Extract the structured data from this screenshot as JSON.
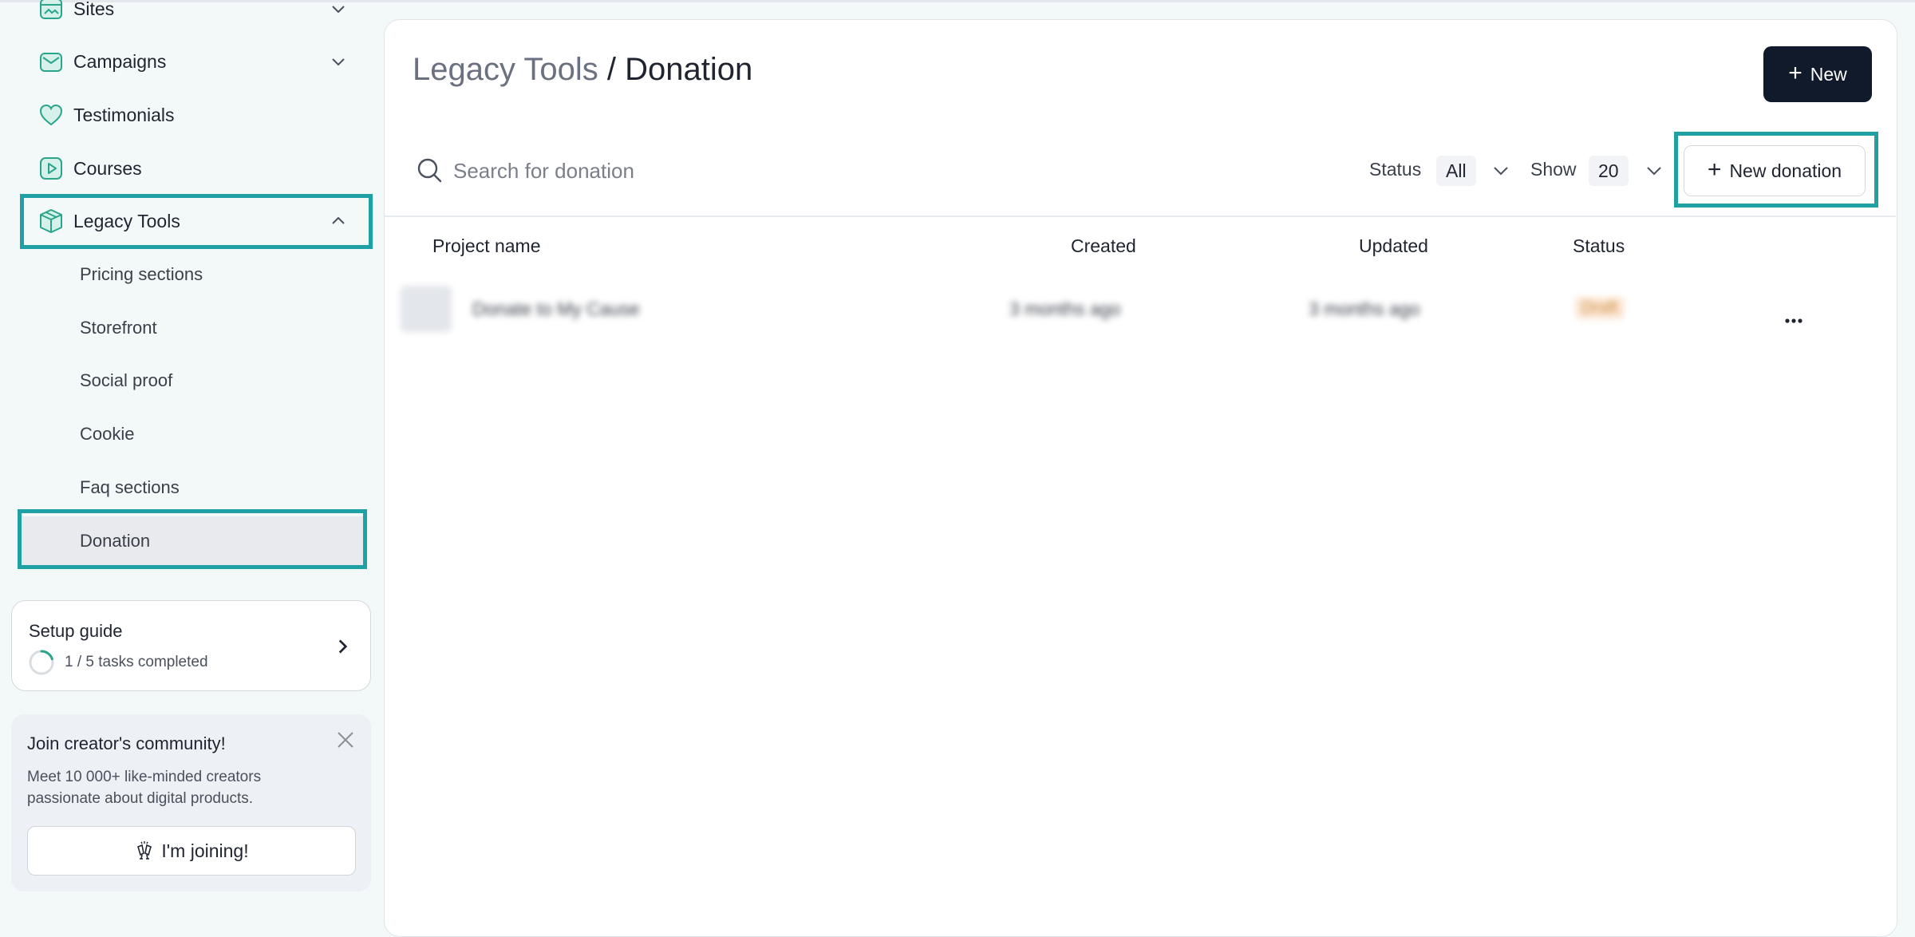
{
  "sidebar": {
    "nav": [
      {
        "label": "Sites",
        "icon": "browser-window-icon"
      },
      {
        "label": "Campaigns",
        "icon": "mail-icon"
      },
      {
        "label": "Testimonials",
        "icon": "heart-icon"
      },
      {
        "label": "Courses",
        "icon": "play-square-icon"
      },
      {
        "label": "Legacy Tools",
        "icon": "box-icon"
      }
    ],
    "legacy_items": [
      {
        "label": "Pricing sections"
      },
      {
        "label": "Storefront"
      },
      {
        "label": "Social proof"
      },
      {
        "label": "Cookie"
      },
      {
        "label": "Faq sections"
      },
      {
        "label": "Donation"
      }
    ],
    "active_item": "Donation",
    "setup_guide": {
      "title": "Setup guide",
      "progress_text": "1 / 5 tasks completed",
      "completed": 1,
      "total": 5
    },
    "community": {
      "title": "Join creator's community!",
      "description": "Meet 10 000+ like-minded creators passionate about digital products.",
      "button_label": "I'm joining!"
    }
  },
  "main": {
    "breadcrumb": {
      "parent": "Legacy Tools",
      "separator": " / ",
      "current": "Donation"
    },
    "new_button_label": "New",
    "search": {
      "placeholder": "Search for donation",
      "value": ""
    },
    "filters": {
      "status_label": "Status",
      "status_value": "All",
      "show_label": "Show",
      "show_value": "20"
    },
    "new_donation_label": "New donation",
    "table": {
      "columns": [
        "Project name",
        "Created",
        "Updated",
        "Status"
      ],
      "rows": [
        {
          "name": "Donate to My Cause",
          "created": "3 months ago",
          "updated": "3 months ago",
          "status": "Draft"
        }
      ]
    }
  },
  "colors": {
    "accent": "#1fa0a4",
    "brand_dark": "#111a2b",
    "icon_teal": "#2aa58c",
    "icon_fill": "#d5f1ea",
    "sidebar_bg": "#f3f8f8"
  }
}
